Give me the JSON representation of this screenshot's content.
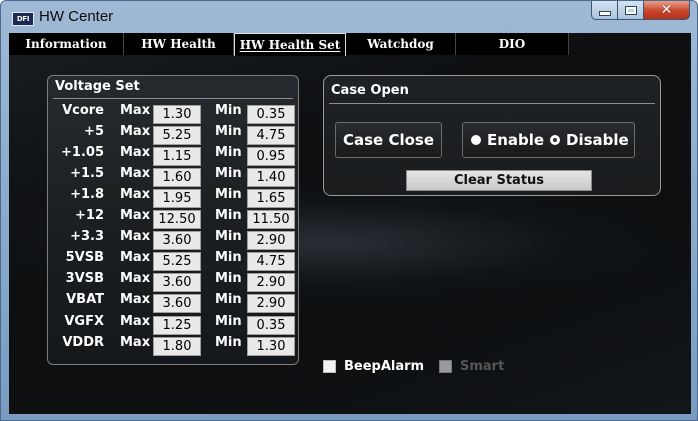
{
  "window": {
    "title": "HW Center",
    "icon_text": "DFI"
  },
  "tabs": [
    {
      "label": "Information"
    },
    {
      "label": "HW Health"
    },
    {
      "label": "HW Health Set",
      "active": true
    },
    {
      "label": "Watchdog"
    },
    {
      "label": "DIO"
    }
  ],
  "voltage_set": {
    "title": "Voltage Set",
    "max_label": "Max",
    "min_label": "Min",
    "rows": [
      {
        "name": "Vcore",
        "max": "1.30",
        "min": "0.35"
      },
      {
        "name": "+5",
        "max": "5.25",
        "min": "4.75"
      },
      {
        "name": "+1.05",
        "max": "1.15",
        "min": "0.95"
      },
      {
        "name": "+1.5",
        "max": "1.60",
        "min": "1.40"
      },
      {
        "name": "+1.8",
        "max": "1.95",
        "min": "1.65"
      },
      {
        "name": "+12",
        "max": "12.50",
        "min": "11.50"
      },
      {
        "name": "+3.3",
        "max": "3.60",
        "min": "2.90"
      },
      {
        "name": "5VSB",
        "max": "5.25",
        "min": "4.75"
      },
      {
        "name": "3VSB",
        "max": "3.60",
        "min": "2.90"
      },
      {
        "name": "VBAT",
        "max": "3.60",
        "min": "2.90"
      },
      {
        "name": "VGFX",
        "max": "1.25",
        "min": "0.35"
      },
      {
        "name": "VDDR",
        "max": "1.80",
        "min": "1.30"
      }
    ]
  },
  "case_open": {
    "title": "Case Open",
    "case_close_label": "Case Close",
    "enable_label": "Enable",
    "disable_label": "Disable",
    "selected": "Disable",
    "clear_status_label": "Clear Status"
  },
  "options": {
    "beep_alarm_label": "BeepAlarm",
    "smart_label": "Smart"
  }
}
